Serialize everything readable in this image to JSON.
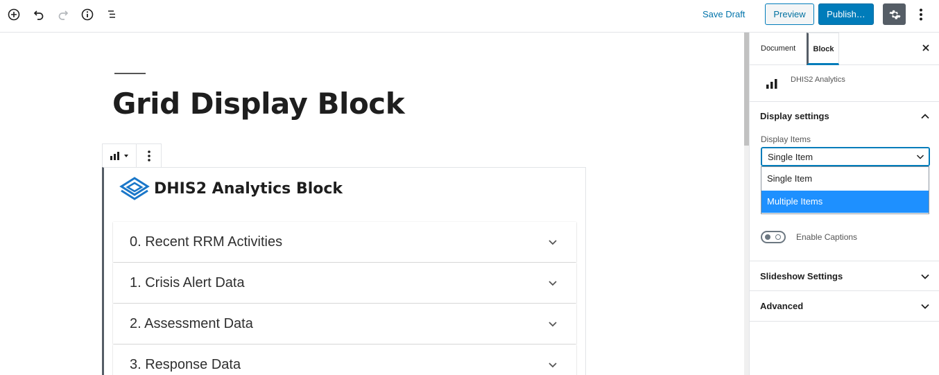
{
  "toolbar": {
    "icons": [
      "add-block-icon",
      "undo-icon",
      "redo-icon",
      "info-icon",
      "list-view-icon"
    ],
    "save_draft": "Save Draft",
    "preview": "Preview",
    "publish": "Publish…",
    "settings_icon": "gear-icon",
    "more_icon": "vertical-ellipsis-icon"
  },
  "editor": {
    "post_title": "Grid Display Block",
    "block": {
      "title": "DHIS2 Analytics Block",
      "items": [
        {
          "label": "0. Recent RRM Activities"
        },
        {
          "label": "1. Crisis Alert Data"
        },
        {
          "label": "2. Assessment Data"
        },
        {
          "label": "3. Response Data"
        }
      ]
    }
  },
  "sidebar": {
    "tabs": {
      "document": "Document",
      "block": "Block"
    },
    "block_name": "DHIS2 Analytics",
    "display_settings": {
      "title": "Display settings",
      "items_label": "Display Items",
      "selected": "Single Item",
      "options": [
        "Single Item",
        "Multiple Items"
      ],
      "highlighted_option": "Multiple Items"
    },
    "captions": {
      "label": "Enable Captions",
      "enabled": false
    },
    "slideshow": {
      "title": "Slideshow Settings"
    },
    "advanced": {
      "title": "Advanced"
    }
  },
  "colors": {
    "accent": "#007cba",
    "dropdown_highlight": "#1e90ff",
    "dhis2_blue": "#1a77c9"
  }
}
